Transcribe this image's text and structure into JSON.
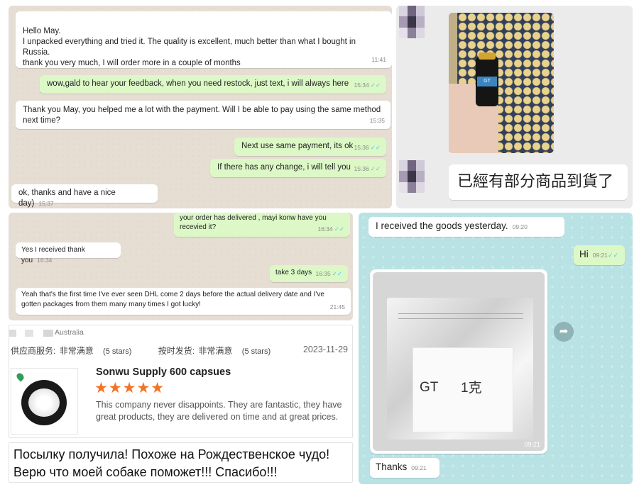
{
  "chat1": {
    "messages": [
      {
        "dir": "in",
        "text": "Hello May.\nI unpacked everything and tried it. The quality is excellent, much better than what I bought in Russia.\n thank you very much, I will order more in a couple of months",
        "time": "11:41"
      },
      {
        "dir": "out",
        "text": "wow,gald to hear your feedback, when you need restock, just text, i will always here",
        "time": "15:34"
      },
      {
        "dir": "in",
        "text": "Thank you May, you helped me a lot with the payment. Will I be able to pay using the same method next time?",
        "time": "15:35"
      },
      {
        "dir": "out",
        "text": "Next use same payment, its ok",
        "time": "15:36"
      },
      {
        "dir": "out",
        "text": "If there has any change, i will tell you",
        "time": "15:36"
      },
      {
        "dir": "in",
        "text": "ok, thanks and have a nice day)",
        "time": "15:37"
      }
    ]
  },
  "photo_chat": {
    "message": "已經有部分商品到貨了",
    "bottle_label": "GT"
  },
  "chat2": {
    "messages": [
      {
        "dir": "out",
        "text": "your order has delivered , mayi konw have you recevied it?",
        "time": "16:34"
      },
      {
        "dir": "in",
        "text": "Yes I received thank you",
        "time": "16:34"
      },
      {
        "dir": "out",
        "text": "take 3 days",
        "time": "16:35"
      },
      {
        "dir": "in",
        "text": "Yeah that's the first time I've ever seen DHL come 2 days before the actual delivery date and I've gotten packages from them many many times I got lucky!",
        "time": "21:45"
      }
    ]
  },
  "review": {
    "country": "Australia",
    "service_label": "供应商服务:",
    "service_value": "非常满意",
    "service_stars": "(5 stars)",
    "shipping_label": "按时发货:",
    "shipping_value": "非常满意",
    "shipping_stars": "(5 stars)",
    "date": "2023-11-29",
    "product_title": "Sonwu Supply 600 capsues",
    "rating": 5,
    "stars": "★★★★★",
    "comment": "This company never disappoints. They are fantastic, they have great products, they are delivered on time and at great prices."
  },
  "russian": {
    "line1": "Посылку получила! Похоже на Рождественское чудо!",
    "line2": "Верю что моей собаке поможет!!! Спасибо!!!"
  },
  "chat3": {
    "m1": {
      "text": "I received the goods yesterday.",
      "time": "09:20"
    },
    "m2": {
      "text": "Hi",
      "time": "09:21"
    },
    "photo": {
      "label1": "GT",
      "label2": "1克",
      "time": "09:21"
    },
    "m3": {
      "text": "Thanks",
      "time": "09:21"
    }
  },
  "colors": {
    "outgoing": "#dcf8c6",
    "incoming": "#ffffff",
    "tick": "#4fc3f7",
    "star": "#f57224",
    "chat_bg": "#e6ddd3",
    "teal_bg": "#b9e2e4"
  }
}
